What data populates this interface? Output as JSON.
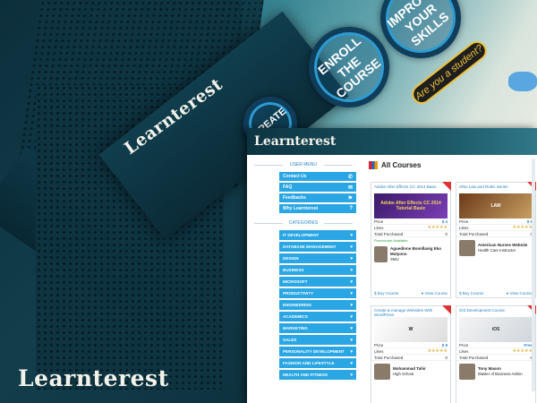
{
  "brand": {
    "logo_text": "Learnterest",
    "logo_bottom": "Learnterest"
  },
  "hero": {
    "circles": [
      "ENROLL THE COURSE",
      "IMPROVE YOUR SKILLS",
      "CREATE"
    ],
    "pill": "Are you a student?"
  },
  "app": {
    "logo_text": "Learnterest",
    "user_menu_title": "USER MENU",
    "user_menu": [
      {
        "label": "Contact Us",
        "icon": "phone-icon",
        "glyph": "✆"
      },
      {
        "label": "FAQ",
        "icon": "chat-icon",
        "glyph": "✉"
      },
      {
        "label": "Feedbacks",
        "icon": "bell-icon",
        "glyph": "⚑"
      },
      {
        "label": "Why Learnterest",
        "icon": "question-icon",
        "glyph": "?"
      }
    ],
    "categories_title": "CATEGORIES",
    "categories": [
      "IT DEVELOPMENT",
      "DATABASE MANAGEMENT",
      "DESIGN",
      "BUSINESS",
      "MICROSOFT",
      "PRODUCTIVITY",
      "ENGINEERING",
      "ACADEMICS",
      "MARKETING",
      "SALES",
      "PERSONALITY DEVELOPMENT",
      "FASHION AND LIFESTYLE",
      "HEALTH AND FITNESS"
    ],
    "main_title": "All Courses",
    "labels": {
      "price": "Price",
      "likes": "Likes",
      "purchased": "Total Purchased",
      "buy": "$ Buy Course",
      "view": "View Course"
    },
    "courses": [
      {
        "title": "Adobe After Effects CC 2014 Basic",
        "thumb": "Adobe After Effects CC 2014 Tutorial Basic",
        "price": "$ 4",
        "likes": "",
        "purchased": "0",
        "promo": "Promocode Available",
        "author_name": "Aguedinne Bomillanig Eko Mulyono",
        "author_org": "SMU"
      },
      {
        "title": "Ohio Law and Rules Series",
        "thumb": "LAW",
        "price": "$ 6",
        "likes": "",
        "purchased": "0",
        "promo": "",
        "author_name": "American Nurses Website",
        "author_org": "Health Care Instructor"
      },
      {
        "title": "Create & manage Websites With WordPress",
        "thumb": "W",
        "price": "$ 9",
        "likes": "",
        "purchased": "0",
        "promo": "",
        "author_name": "Mohammad Tahir",
        "author_org": "High School"
      },
      {
        "title": "iOS Development Course",
        "thumb": "iOS",
        "price": "Free",
        "likes": "",
        "purchased": "6",
        "promo": "",
        "author_name": "Tony Mason",
        "author_org": "Master of Business Admin"
      }
    ]
  },
  "colors": {
    "accent": "#29a6e3",
    "header": "#0d3441",
    "gold": "#e6b33a"
  }
}
